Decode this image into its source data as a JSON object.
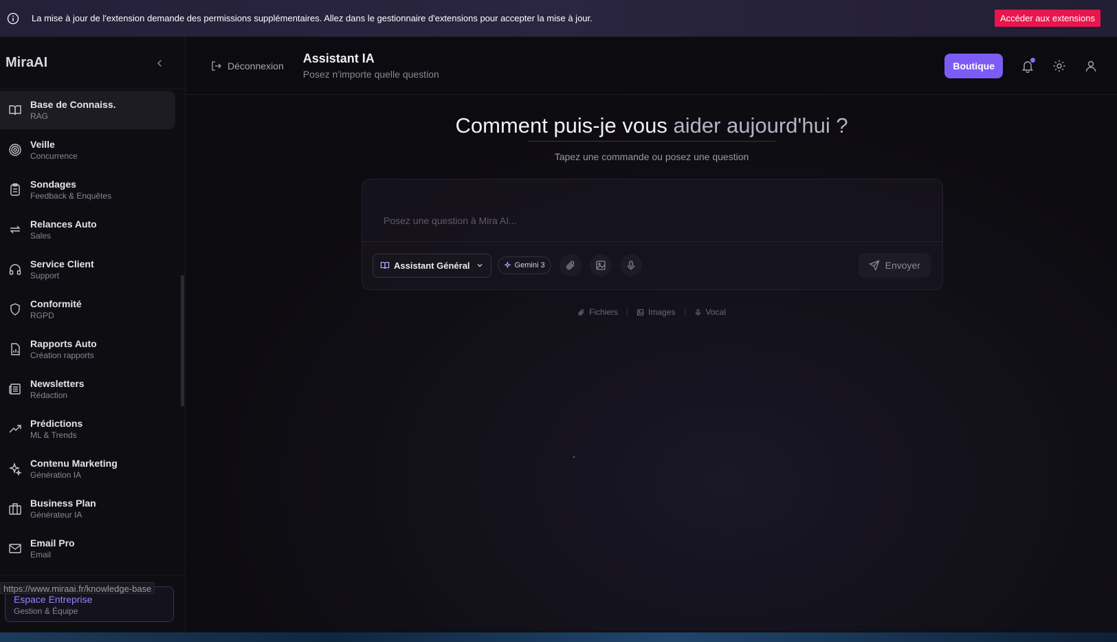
{
  "banner": {
    "message": "La mise à jour de l'extension demande des permissions supplémentaires. Allez dans le gestionnaire d'extensions pour accepter la mise à jour.",
    "button_label": "Accéder aux extensions",
    "icon": "info-icon"
  },
  "sidebar": {
    "brand": "MiraAI",
    "items": [
      {
        "label": "Base de Connaiss.",
        "sub": "RAG",
        "icon": "book-icon",
        "active": true
      },
      {
        "label": "Veille",
        "sub": "Concurrence",
        "icon": "target-icon"
      },
      {
        "label": "Sondages",
        "sub": "Feedback & Enquêtes",
        "icon": "clipboard-icon"
      },
      {
        "label": "Relances Auto",
        "sub": "Sales",
        "icon": "repeat-icon"
      },
      {
        "label": "Service Client",
        "sub": "Support",
        "icon": "headphones-icon"
      },
      {
        "label": "Conformité",
        "sub": "RGPD",
        "icon": "shield-icon"
      },
      {
        "label": "Rapports Auto",
        "sub": "Création rapports",
        "icon": "report-icon"
      },
      {
        "label": "Newsletters",
        "sub": "Rédaction",
        "icon": "newspaper-icon"
      },
      {
        "label": "Prédictions",
        "sub": "ML & Trends",
        "icon": "trend-up-icon"
      },
      {
        "label": "Contenu Marketing",
        "sub": "Génération IA",
        "icon": "sparkles-icon"
      },
      {
        "label": "Business Plan",
        "sub": "Générateur IA",
        "icon": "building-icon"
      },
      {
        "label": "Email Pro",
        "sub": "Email",
        "icon": "mail-icon"
      }
    ],
    "enterprise": {
      "title": "Espace Entreprise",
      "sub": "Gestion & Équipe"
    },
    "status_url": "https://www.miraai.fr/knowledge-base"
  },
  "topbar": {
    "logout_label": "Déconnexion",
    "title": "Assistant IA",
    "subtitle": "Posez n'importe quelle question",
    "shop_label": "Boutique"
  },
  "main": {
    "hero_title_main": "Comment puis-je vous ",
    "hero_title_muted": "aider aujourd'hui ?",
    "hero_sub": "Tapez une commande ou posez une question",
    "input_placeholder": "Posez une question à Mira AI...",
    "assistant_select": "Assistant Général",
    "model_badge": "Gemini 3",
    "send_label": "Envoyer",
    "hints": [
      "Fichiers",
      "Images",
      "Vocal"
    ]
  },
  "colors": {
    "accent": "#7c5cf5",
    "banner_button": "#e8164d",
    "background": "#0c0b0f"
  }
}
